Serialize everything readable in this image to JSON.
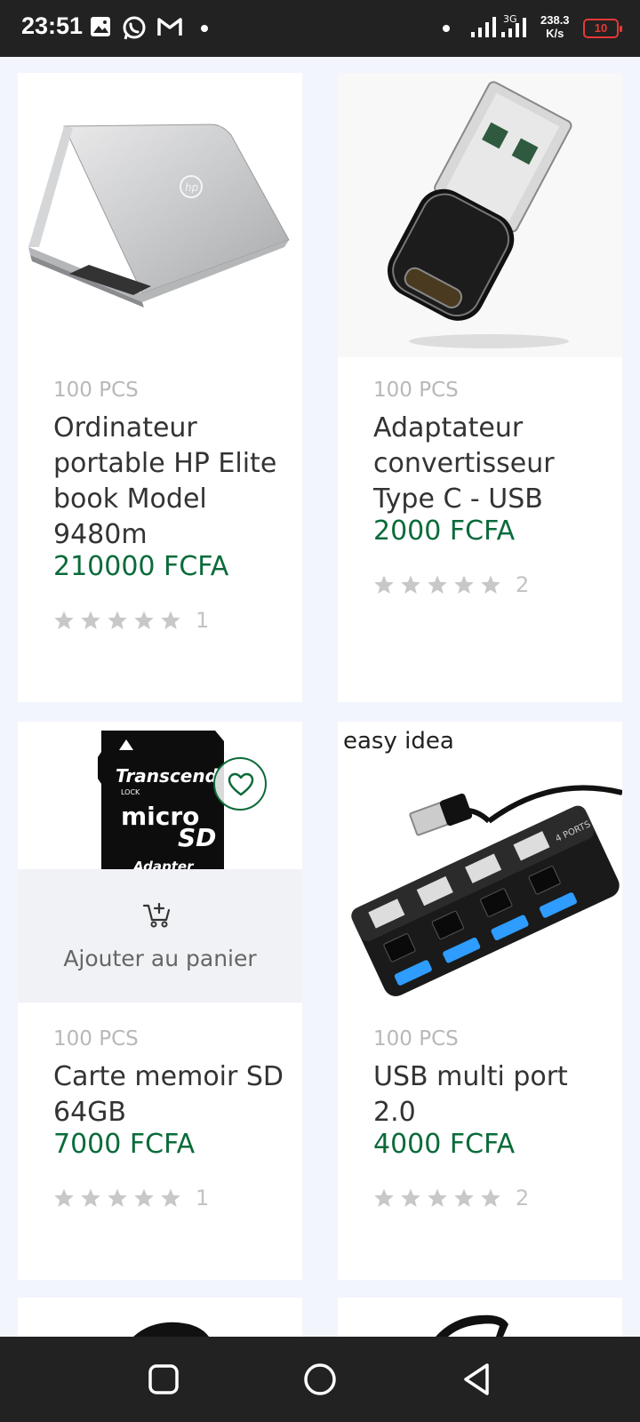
{
  "status_bar": {
    "time": "23:51",
    "net_speed_value": "238.3",
    "net_speed_unit": "K/s",
    "battery": "10",
    "network_label": "3G"
  },
  "products": [
    {
      "quantity": "100 PCS",
      "name": "Ordinateur portable HP Elite book Model 9480m",
      "price": "210000 FCFA",
      "rating_count": "1",
      "image": "hp-laptop-image"
    },
    {
      "quantity": "100 PCS",
      "name": "Adaptateur convertisseur Type C - USB",
      "price": "2000 FCFA",
      "rating_count": "2",
      "image": "usb-adapter-image"
    },
    {
      "quantity": "100 PCS",
      "name": "Carte memoir SD 64GB",
      "price": "7000 FCFA",
      "rating_count": "1",
      "image": "sd-card-image",
      "image_text": [
        "Transcend",
        "LOCK",
        "micro",
        "SD",
        "Adapter"
      ]
    },
    {
      "quantity": "100 PCS",
      "name": "USB multi port 2.0",
      "price": "4000 FCFA",
      "rating_count": "2",
      "image": "usb-hub-image",
      "image_text": [
        "easy idea",
        "4 PORTS"
      ]
    }
  ],
  "cart_overlay": {
    "label": "Ajouter au panier"
  },
  "colors": {
    "price": "#0b6b3a",
    "star": "#c8c8c8",
    "background": "#f3f5fd"
  }
}
